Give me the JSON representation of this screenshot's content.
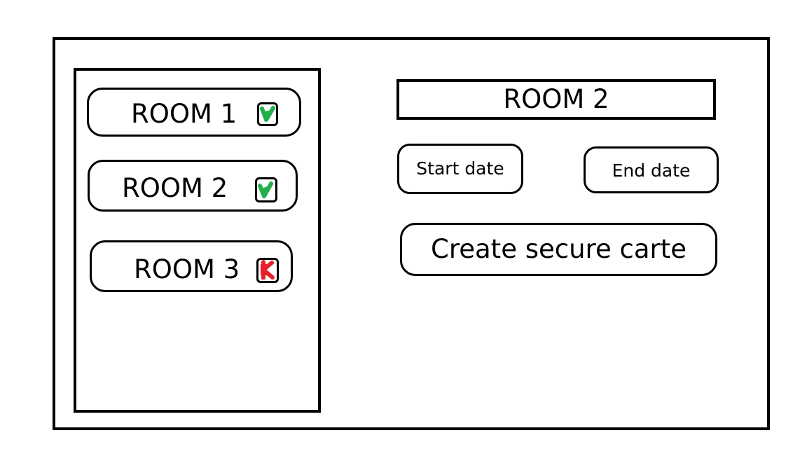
{
  "rooms": [
    {
      "label": "ROOM 1",
      "status": "available",
      "status_icon": "check-icon",
      "status_color": "#21b04b"
    },
    {
      "label": "ROOM 2",
      "status": "available",
      "status_icon": "check-icon",
      "status_color": "#21b04b"
    },
    {
      "label": "ROOM 3",
      "status": "unavailable",
      "status_icon": "cross-icon",
      "status_color": "#e8202a"
    }
  ],
  "detail": {
    "title": "ROOM 2",
    "start_date_label": "Start date",
    "end_date_label": "End date",
    "create_button_label": "Create secure carte"
  }
}
